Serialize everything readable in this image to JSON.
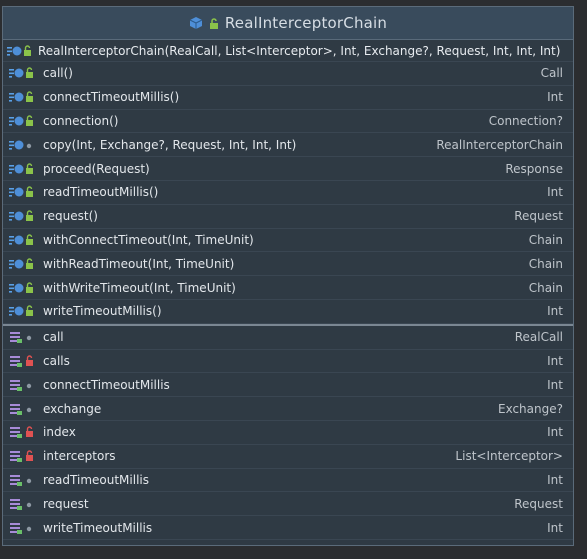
{
  "window": {
    "title": "RealInterceptorChain"
  },
  "constructor": {
    "signature": "RealInterceptorChain(RealCall, List<Interceptor>, Int, Exchange?, Request, Int, Int, Int)"
  },
  "methods": [
    {
      "name": "call()",
      "type": "Call",
      "visibility": "public"
    },
    {
      "name": "connectTimeoutMillis()",
      "type": "Int",
      "visibility": "public"
    },
    {
      "name": "connection()",
      "type": "Connection?",
      "visibility": "public"
    },
    {
      "name": "copy(Int, Exchange?, Request, Int, Int, Int)",
      "type": "RealInterceptorChain",
      "visibility": "internal"
    },
    {
      "name": "proceed(Request)",
      "type": "Response",
      "visibility": "public"
    },
    {
      "name": "readTimeoutMillis()",
      "type": "Int",
      "visibility": "public"
    },
    {
      "name": "request()",
      "type": "Request",
      "visibility": "public"
    },
    {
      "name": "withConnectTimeout(Int, TimeUnit)",
      "type": "Chain",
      "visibility": "public"
    },
    {
      "name": "withReadTimeout(Int, TimeUnit)",
      "type": "Chain",
      "visibility": "public"
    },
    {
      "name": "withWriteTimeout(Int, TimeUnit)",
      "type": "Chain",
      "visibility": "public"
    },
    {
      "name": "writeTimeoutMillis()",
      "type": "Int",
      "visibility": "public"
    }
  ],
  "fields": [
    {
      "name": "call",
      "type": "RealCall",
      "visibility": "internal"
    },
    {
      "name": "calls",
      "type": "Int",
      "visibility": "private"
    },
    {
      "name": "connectTimeoutMillis",
      "type": "Int",
      "visibility": "internal"
    },
    {
      "name": "exchange",
      "type": "Exchange?",
      "visibility": "internal"
    },
    {
      "name": "index",
      "type": "Int",
      "visibility": "private"
    },
    {
      "name": "interceptors",
      "type": "List<Interceptor>",
      "visibility": "private"
    },
    {
      "name": "readTimeoutMillis",
      "type": "Int",
      "visibility": "internal"
    },
    {
      "name": "request",
      "type": "Request",
      "visibility": "internal"
    },
    {
      "name": "writeTimeoutMillis",
      "type": "Int",
      "visibility": "internal"
    }
  ]
}
